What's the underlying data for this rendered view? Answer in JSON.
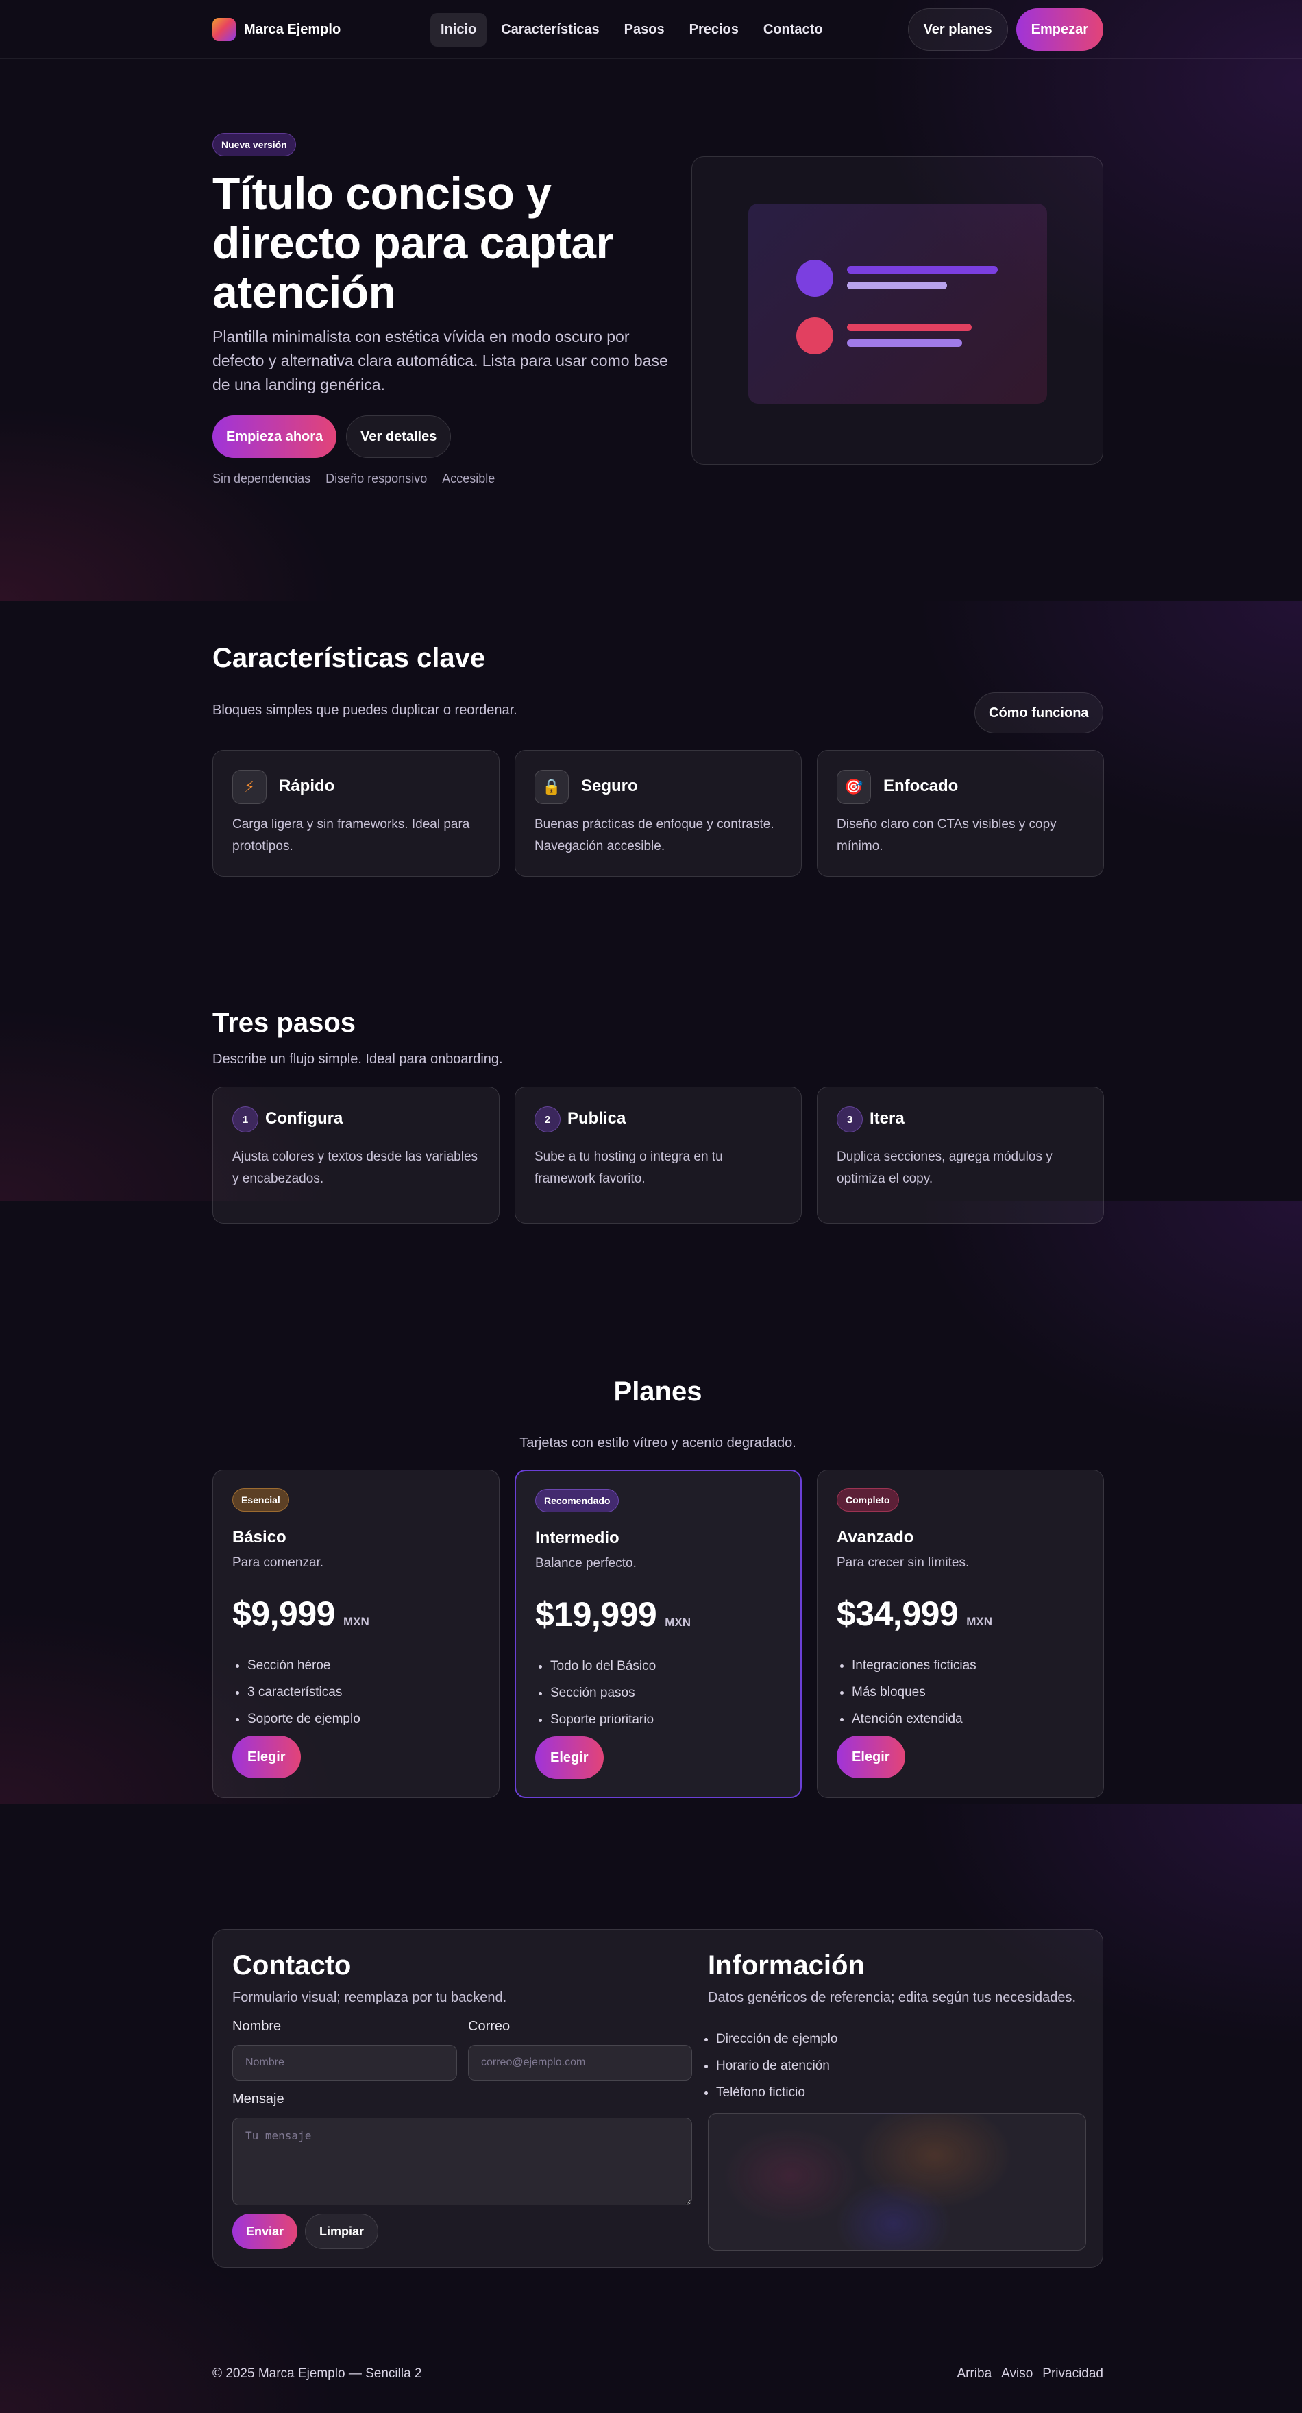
{
  "nav": {
    "brand": "Marca Ejemplo",
    "items": [
      "Inicio",
      "Características",
      "Pasos",
      "Precios",
      "Contacto"
    ],
    "active": "Inicio",
    "see_plans": "Ver planes",
    "start": "Empezar"
  },
  "hero": {
    "badge": "Nueva versión",
    "title": "Título conciso y directo para captar atención",
    "subtitle": "Plantilla minimalista con estética vívida en modo oscuro por defecto y alternativa clara automática. Lista para usar como base de una landing genérica.",
    "primary_cta": "Empieza ahora",
    "secondary_cta": "Ver detalles",
    "tags": [
      "Sin dependencias",
      "Diseño responsivo",
      "Accesible"
    ]
  },
  "features": {
    "title": "Características clave",
    "subtitle": "Bloques simples que puedes duplicar o reordenar.",
    "how_button": "Cómo funciona",
    "items": [
      {
        "icon": "lightning-icon",
        "glyph": "⚡",
        "title": "Rápido",
        "text": "Carga ligera y sin frameworks. Ideal para prototipos."
      },
      {
        "icon": "lock-icon",
        "glyph": "🔒",
        "title": "Seguro",
        "text": "Buenas prácticas de enfoque y contraste. Navegación accesible."
      },
      {
        "icon": "target-icon",
        "glyph": "🎯",
        "title": "Enfocado",
        "text": "Diseño claro con CTAs visibles y copy mínimo."
      }
    ]
  },
  "steps": {
    "title": "Tres pasos",
    "subtitle": "Describe un flujo simple. Ideal para onboarding.",
    "items": [
      {
        "num": "1",
        "title": "Configura",
        "text": "Ajusta colores y textos desde las variables y encabezados."
      },
      {
        "num": "2",
        "title": "Publica",
        "text": "Sube a tu hosting o integra en tu framework favorito."
      },
      {
        "num": "3",
        "title": "Itera",
        "text": "Duplica secciones, agrega módulos y optimiza el copy."
      }
    ]
  },
  "pricing": {
    "title": "Planes",
    "subtitle": "Tarjetas con estilo vítreo y acento degradado.",
    "plans": [
      {
        "badge": "Esencial",
        "name": "Básico",
        "desc": "Para comenzar.",
        "price": "$9,999",
        "currency": "MXN",
        "features": [
          "Sección héroe",
          "3 características",
          "Soporte de ejemplo"
        ],
        "cta": "Elegir"
      },
      {
        "badge": "Recomendado",
        "name": "Intermedio",
        "desc": "Balance perfecto.",
        "price": "$19,999",
        "currency": "MXN",
        "features": [
          "Todo lo del Básico",
          "Sección pasos",
          "Soporte prioritario"
        ],
        "cta": "Elegir"
      },
      {
        "badge": "Completo",
        "name": "Avanzado",
        "desc": "Para crecer sin límites.",
        "price": "$34,999",
        "currency": "MXN",
        "features": [
          "Integraciones ficticias",
          "Más bloques",
          "Atención extendida"
        ],
        "cta": "Elegir"
      }
    ]
  },
  "contact": {
    "title": "Contacto",
    "subtitle": "Formulario visual; reemplaza por tu backend.",
    "name_label": "Nombre",
    "name_placeholder": "Nombre",
    "email_label": "Correo",
    "email_placeholder": "correo@ejemplo.com",
    "message_label": "Mensaje",
    "message_placeholder": "Tu mensaje",
    "send": "Enviar",
    "clear": "Limpiar"
  },
  "info": {
    "title": "Información",
    "subtitle": "Datos genéricos de referencia; edita según tus necesidades.",
    "items": [
      "Dirección de ejemplo",
      "Horario de atención",
      "Teléfono ficticio"
    ]
  },
  "footer": {
    "copyright": "© 2025 Marca Ejemplo — Sencilla 2",
    "links": [
      "Arriba",
      "Aviso",
      "Privacidad"
    ]
  },
  "colors": {
    "accent_start": "#a034d8",
    "accent_end": "#e24478",
    "background": "#0f0c17"
  }
}
